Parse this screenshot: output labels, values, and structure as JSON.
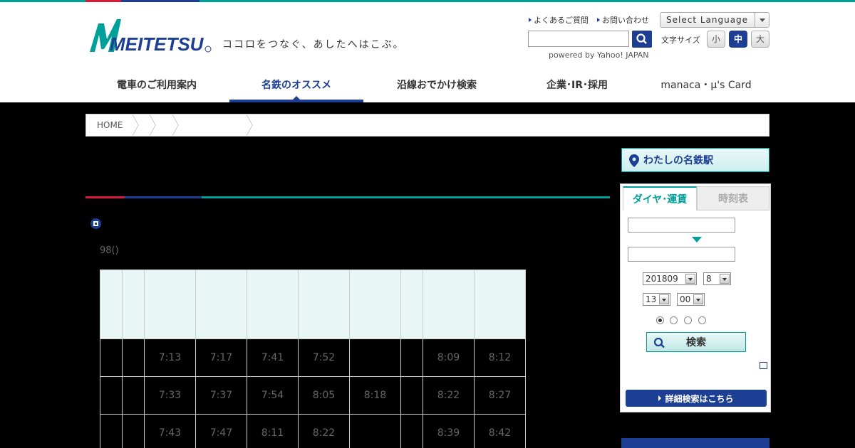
{
  "header": {
    "brand": "MEITETSU",
    "tagline": "ココロをつなぐ、あしたへはこぶ。",
    "util_links": [
      "よくあるご質問",
      "お問い合わせ"
    ],
    "language_select": "Select Language",
    "powered_by": "powered by Yahoo! JAPAN",
    "font_size_label": "文字サイズ",
    "font_sizes": [
      "小",
      "中",
      "大"
    ]
  },
  "nav": {
    "items": [
      {
        "label": "電車のご利用案内"
      },
      {
        "label": "名鉄のオススメ"
      },
      {
        "label": "沿線おでかけ検索"
      },
      {
        "label": "企業･IR･採用"
      },
      {
        "label": "manaca・μ's Card"
      }
    ]
  },
  "breadcrumb": {
    "home": "HOME"
  },
  "main": {
    "title": "",
    "section_heading": "",
    "note": "98()",
    "table": {
      "rows": [
        [
          "",
          "",
          "7:13",
          "7:17",
          "7:41",
          "7:52",
          "",
          "",
          "8:09",
          "8:12"
        ],
        [
          "",
          "",
          "7:33",
          "7:37",
          "7:54",
          "8:05",
          "8:18",
          "",
          "8:22",
          "8:27"
        ],
        [
          "",
          "",
          "7:43",
          "7:47",
          "8:11",
          "8:22",
          "",
          "",
          "8:39",
          "8:42"
        ]
      ]
    }
  },
  "sidebar": {
    "my_station": "わたしの名鉄駅",
    "tabs": [
      "ダイヤ･運賃",
      "時刻表"
    ],
    "year_month": "201809",
    "day": "8",
    "hour": "13",
    "minute": "00",
    "search_label": "検索",
    "detail_label": "詳細検索はこちら"
  },
  "colors": {
    "brand_blue": "#1c3f94",
    "brand_teal": "#00a09a",
    "brand_red": "#d7193a"
  }
}
